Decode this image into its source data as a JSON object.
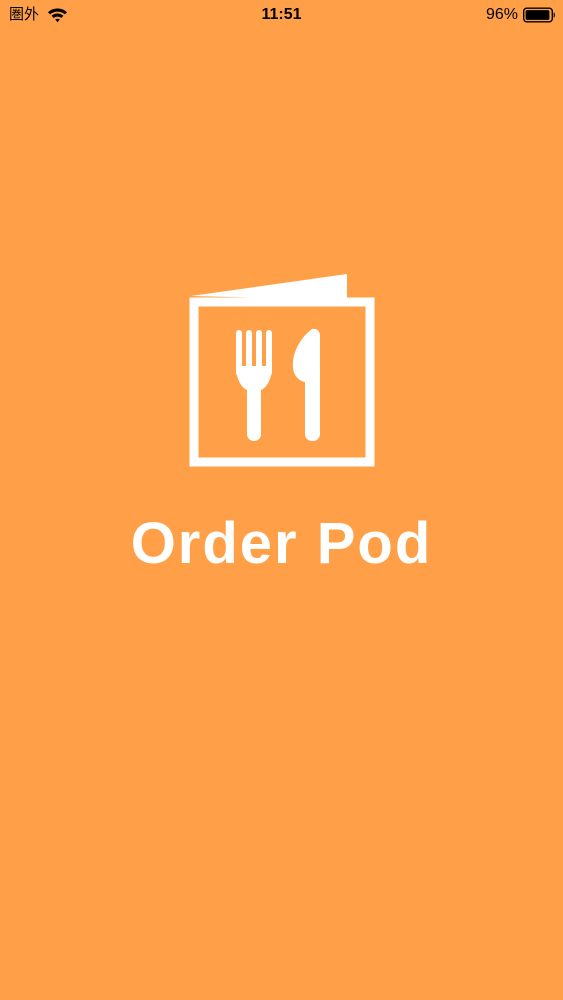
{
  "status_bar": {
    "carrier": "圏外",
    "time": "11:51",
    "battery_percent": "96%",
    "battery_level": 0.96,
    "wifi_icon": "wifi-icon",
    "battery_icon": "battery-icon"
  },
  "splash": {
    "app_name": "Order Pod",
    "logo_icon": "menu-fork-knife-icon",
    "background_color": "#FFA048",
    "foreground_color": "#FFFFFF"
  }
}
